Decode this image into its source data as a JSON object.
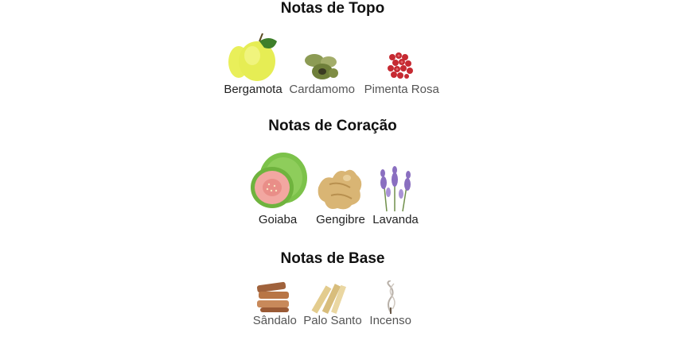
{
  "sections": [
    {
      "title": "Notas de Topo",
      "notes": [
        {
          "label": "Bergamota",
          "icon": "bergamot-icon"
        },
        {
          "label": "Cardamomo",
          "icon": "cardamom-icon"
        },
        {
          "label": "Pimenta Rosa",
          "icon": "pink-pepper-icon"
        }
      ]
    },
    {
      "title": "Notas de Coração",
      "notes": [
        {
          "label": "Goiaba",
          "icon": "guava-icon"
        },
        {
          "label": "Gengibre",
          "icon": "ginger-icon"
        },
        {
          "label": "Lavanda",
          "icon": "lavender-icon"
        }
      ]
    },
    {
      "title": "Notas de Base",
      "notes": [
        {
          "label": "Sândalo",
          "icon": "sandalwood-icon"
        },
        {
          "label": "Palo Santo",
          "icon": "palo-santo-icon"
        },
        {
          "label": "Incenso",
          "icon": "incense-icon"
        }
      ]
    }
  ]
}
